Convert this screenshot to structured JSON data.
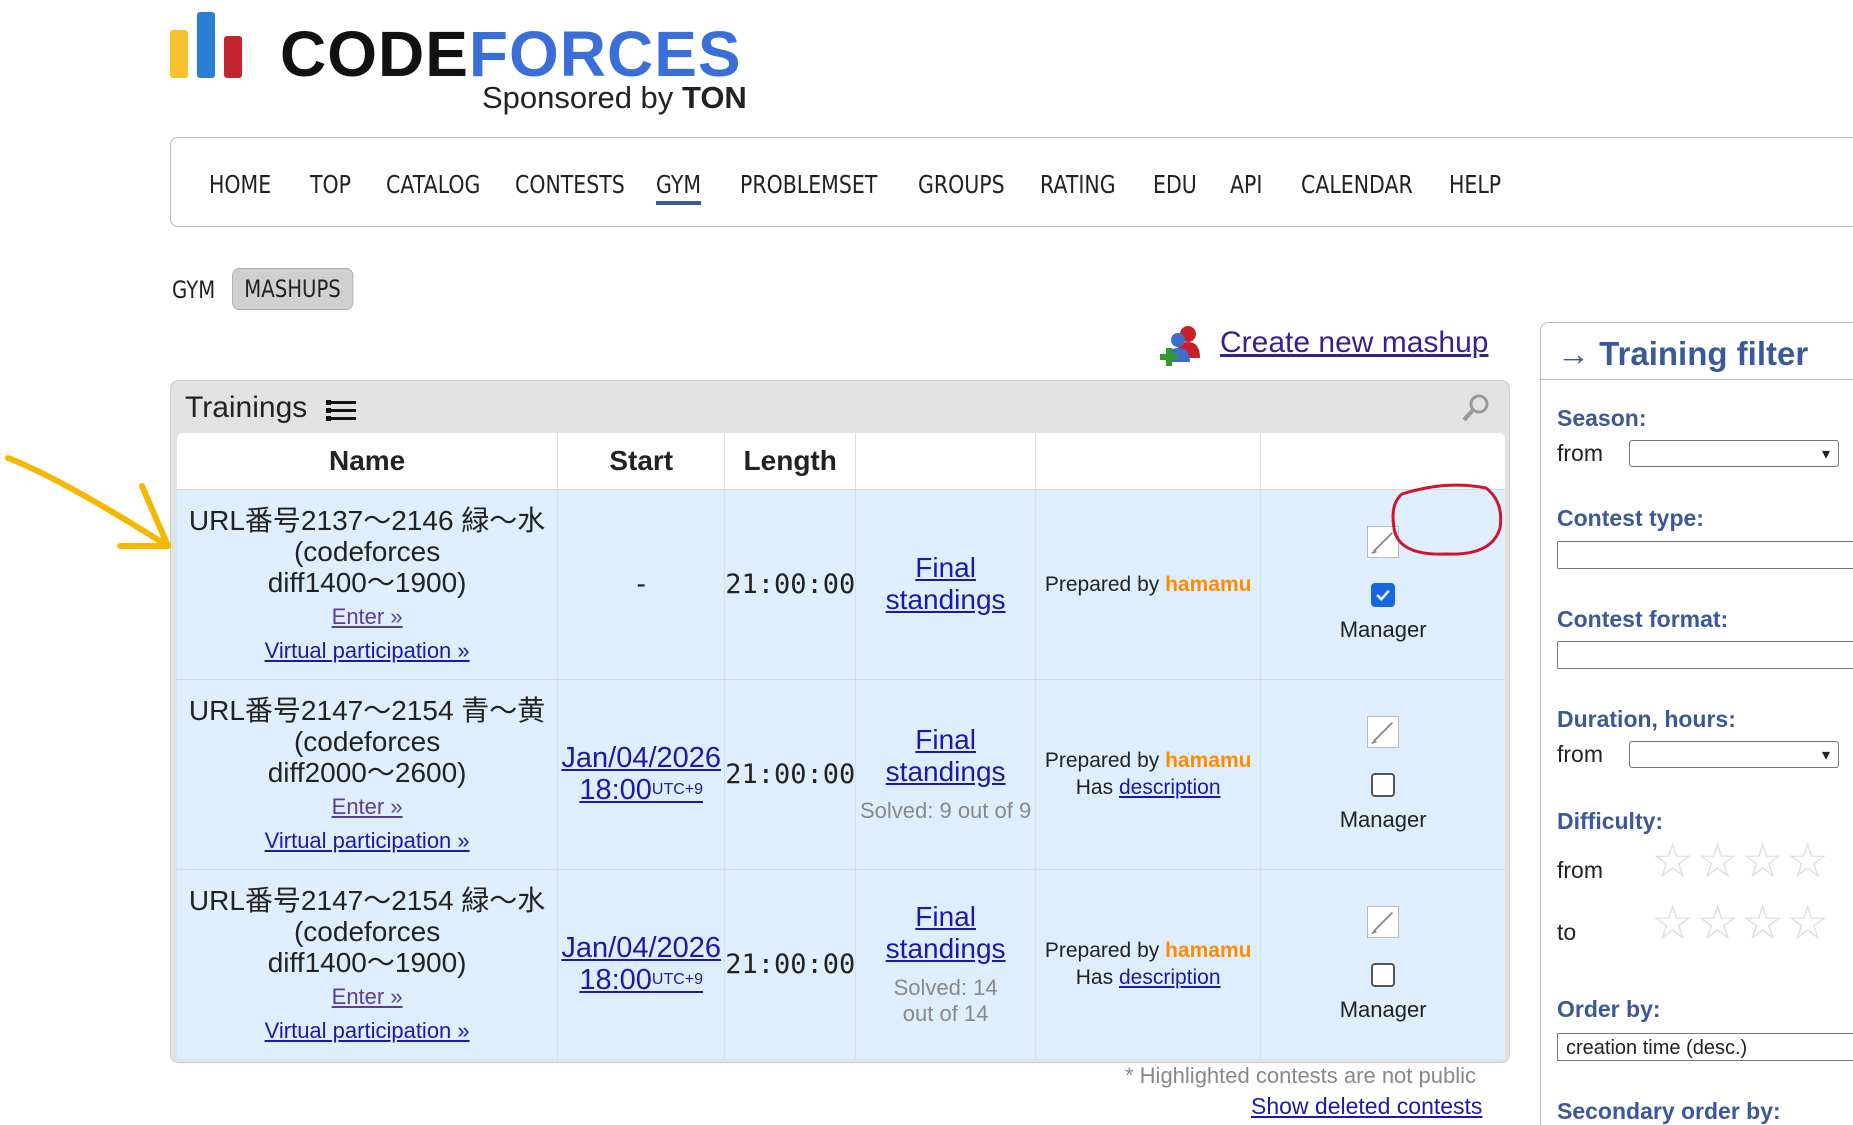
{
  "logo": {
    "word_dark": "CODE",
    "word_blue": "FORCES",
    "sponsored_prefix": "Sponsored by",
    "sponsor": "TON"
  },
  "nav": {
    "items": [
      "HOME",
      "TOP",
      "CATALOG",
      "CONTESTS",
      "GYM",
      "PROBLEMSET",
      "GROUPS",
      "RATING",
      "EDU",
      "API",
      "CALENDAR",
      "HELP"
    ],
    "active": "GYM"
  },
  "subtabs": {
    "gym": "GYM",
    "mashups": "MASHUPS"
  },
  "create_mashup": "Create new mashup",
  "trainings": {
    "title": "Trainings",
    "columns": {
      "name": "Name",
      "start": "Start",
      "length": "Length"
    },
    "rows": [
      {
        "name1": "URL番号2137～2146 緑～水",
        "name2": "(codeforces",
        "name3": "diff1400～1900)",
        "enter": "Enter »",
        "virtual": "Virtual participation »",
        "start": "-",
        "date": "",
        "time": "",
        "tz": "",
        "length": "21:00:00",
        "final1": "Final",
        "final2": "standings",
        "solved": "",
        "prepared": "Prepared by",
        "author": "hamamu",
        "has": "",
        "description": "",
        "manager": "Manager",
        "checked": true
      },
      {
        "name1": "URL番号2147～2154 青～黄",
        "name2": "(codeforces",
        "name3": "diff2000～2600)",
        "enter": "Enter »",
        "virtual": "Virtual participation »",
        "start": "",
        "date": "Jan/04/2026",
        "time": "18:00",
        "tz": "UTC+9",
        "length": "21:00:00",
        "final1": "Final",
        "final2": "standings",
        "solved": "Solved: 9 out of 9",
        "prepared": "Prepared by",
        "author": "hamamu",
        "has": "Has",
        "description": "description",
        "manager": "Manager",
        "checked": false
      },
      {
        "name1": "URL番号2147～2154 緑～水",
        "name2": "(codeforces",
        "name3": "diff1400～1900)",
        "enter": "Enter »",
        "virtual": "Virtual participation »",
        "start": "",
        "date": "Jan/04/2026",
        "time": "18:00",
        "tz": "UTC+9",
        "length": "21:00:00",
        "final1": "Final",
        "final2": "standings",
        "solved": "Solved: 14 out of 14",
        "prepared": "Prepared by",
        "author": "hamamu",
        "has": "Has",
        "description": "description",
        "manager": "Manager",
        "checked": false
      }
    ]
  },
  "footer": {
    "note": "* Highlighted contests are not public",
    "show_deleted": "Show deleted contests"
  },
  "filter": {
    "title": "→ Training filter",
    "season": "Season:",
    "from": "from",
    "to": "to",
    "contest_type": "Contest type:",
    "contest_format": "Contest format:",
    "duration": "Duration, hours:",
    "difficulty": "Difficulty:",
    "order_by": "Order by:",
    "order_value": "creation time (desc.)",
    "secondary": "Secondary order by:"
  },
  "colors": {
    "accent": "#3b5998",
    "author": "#ff8c00",
    "link": "#1a1aa6",
    "annotation_arrow": "#f5b800",
    "annotation_circle": "#d0142c"
  }
}
